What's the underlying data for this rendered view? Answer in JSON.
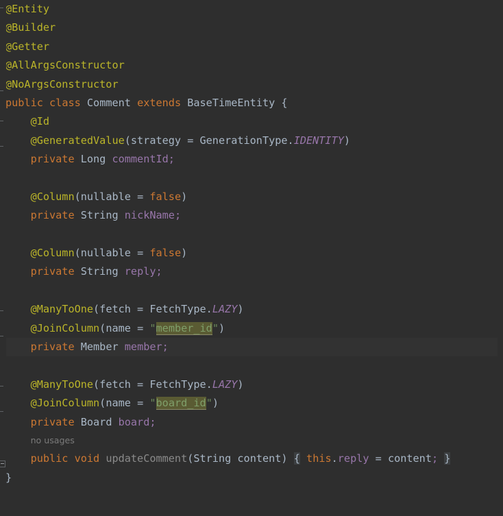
{
  "editor": {
    "language": "java",
    "theme": "darcula",
    "background_color": "#2e2e2e",
    "current_line_color": "#323232",
    "default_text_color": "#a9b7c6",
    "colors": {
      "annotation": "#bbb529",
      "keyword": "#cc7832",
      "field": "#9876aa",
      "string": "#6a8759",
      "static_italic": "#9876aa",
      "method_declaration": "#8a8a8a",
      "inlay_hint": "#7a7a7a",
      "search_highlight_bg": "#5a5b33",
      "fold_brace_bg": "#3c3f41",
      "gutter_fold_line": "#606366"
    }
  },
  "code": {
    "lines": [
      {
        "n": 1,
        "type": "code",
        "indent": 0,
        "text": "@Entity"
      },
      {
        "n": 2,
        "type": "code",
        "indent": 0,
        "text": "@Builder"
      },
      {
        "n": 3,
        "type": "code",
        "indent": 0,
        "text": "@Getter"
      },
      {
        "n": 4,
        "type": "code",
        "indent": 0,
        "text": "@AllArgsConstructor"
      },
      {
        "n": 5,
        "type": "code",
        "indent": 0,
        "text": "@NoArgsConstructor"
      },
      {
        "n": 6,
        "type": "code",
        "indent": 0,
        "text": "public class Comment extends BaseTimeEntity {"
      },
      {
        "n": 7,
        "type": "code",
        "indent": 1,
        "text": "@Id"
      },
      {
        "n": 8,
        "type": "code",
        "indent": 1,
        "text": "@GeneratedValue(strategy = GenerationType.IDENTITY)"
      },
      {
        "n": 9,
        "type": "code",
        "indent": 1,
        "text": "private Long commentId;"
      },
      {
        "n": 10,
        "type": "blank",
        "indent": 0,
        "text": ""
      },
      {
        "n": 11,
        "type": "code",
        "indent": 1,
        "text": "@Column(nullable = false)"
      },
      {
        "n": 12,
        "type": "code",
        "indent": 1,
        "text": "private String nickName;"
      },
      {
        "n": 13,
        "type": "blank",
        "indent": 0,
        "text": ""
      },
      {
        "n": 14,
        "type": "code",
        "indent": 1,
        "text": "@Column(nullable = false)"
      },
      {
        "n": 15,
        "type": "code",
        "indent": 1,
        "text": "private String reply;"
      },
      {
        "n": 16,
        "type": "blank",
        "indent": 0,
        "text": ""
      },
      {
        "n": 17,
        "type": "code",
        "indent": 1,
        "text": "@ManyToOne(fetch = FetchType.LAZY)"
      },
      {
        "n": 18,
        "type": "code",
        "indent": 1,
        "text": "@JoinColumn(name = \"member_id\")"
      },
      {
        "n": 19,
        "type": "code",
        "indent": 1,
        "text": "private Member member;",
        "current": true
      },
      {
        "n": 20,
        "type": "blank",
        "indent": 0,
        "text": ""
      },
      {
        "n": 21,
        "type": "code",
        "indent": 1,
        "text": "@ManyToOne(fetch = FetchType.LAZY)"
      },
      {
        "n": 22,
        "type": "code",
        "indent": 1,
        "text": "@JoinColumn(name = \"board_id\")"
      },
      {
        "n": 23,
        "type": "code",
        "indent": 1,
        "text": "private Board board;"
      },
      {
        "n": 24,
        "type": "hint",
        "indent": 1,
        "text": "no usages"
      },
      {
        "n": 25,
        "type": "code",
        "indent": 1,
        "text": "public void updateComment(String content) { this.reply = content; }"
      },
      {
        "n": 26,
        "type": "code",
        "indent": 0,
        "text": "}"
      }
    ]
  },
  "tokens": {
    "annotations": {
      "entity": "@Entity",
      "builder": "@Builder",
      "getter": "@Getter",
      "all_args_constructor": "@AllArgsConstructor",
      "no_args_constructor": "@NoArgsConstructor",
      "id": "@Id",
      "generated_value": "@GeneratedValue",
      "column": "@Column",
      "many_to_one": "@ManyToOne",
      "join_column": "@JoinColumn"
    },
    "keywords": {
      "public": "public",
      "class": "class",
      "extends": "extends",
      "private": "private",
      "void": "void",
      "this": "this",
      "false": "false"
    },
    "class_name": "Comment",
    "super_class": "BaseTimeEntity",
    "types": {
      "long": "Long",
      "string": "String",
      "member": "Member",
      "board": "Board",
      "generation_type": "GenerationType",
      "fetch_type": "FetchType"
    },
    "fields": {
      "comment_id": "commentId",
      "nick_name": "nickName",
      "reply": "reply",
      "member": "member",
      "board": "board"
    },
    "enum_constants": {
      "identity": "IDENTITY",
      "lazy": "LAZY"
    },
    "attributes": {
      "strategy": "strategy",
      "nullable": "nullable",
      "fetch": "fetch",
      "name": "name"
    },
    "method": {
      "name": "updateComment",
      "param_type": "String",
      "param_name": "content",
      "body": "this.reply = content;",
      "open_brace": "{",
      "close_brace": "}"
    },
    "highlighted_strings": {
      "member_id": "member_id",
      "board_id": "board_id"
    },
    "punct": {
      "open_paren": "(",
      "close_paren": ")",
      "semicolon": ";",
      "equals": "=",
      "dot": ".",
      "quote": "\"",
      "open_brace": "{",
      "close_brace": "}"
    },
    "inlay_hints": {
      "no_usages": "no usages"
    }
  }
}
